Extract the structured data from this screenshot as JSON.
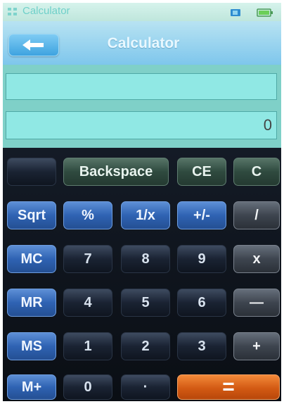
{
  "status_bar": {
    "app_icon": "grid-app-icon",
    "title": "Calculator",
    "sim_icon": "sim-card-icon",
    "battery_icon": "battery-icon"
  },
  "header": {
    "back_icon": "arrow-left-icon",
    "title": "Calculator"
  },
  "display": {
    "memory": "",
    "result": "0"
  },
  "keys": {
    "blank": "",
    "backspace": "Backspace",
    "ce": "CE",
    "c": "C",
    "sqrt": "Sqrt",
    "percent": "%",
    "reciprocal": "1/x",
    "negate": "+/-",
    "divide": "/",
    "mc": "MC",
    "seven": "7",
    "eight": "8",
    "nine": "9",
    "multiply": "x",
    "mr": "MR",
    "four": "4",
    "five": "5",
    "six": "6",
    "subtract": "—",
    "ms": "MS",
    "one": "1",
    "two": "2",
    "three": "3",
    "add": "+",
    "mplus": "M+",
    "zero": "0",
    "decimal": "·",
    "equals": "="
  },
  "colors": {
    "accent_orange": "#d35a13",
    "memory_blue": "#2f63b3",
    "display_bg": "#90e8e4"
  }
}
